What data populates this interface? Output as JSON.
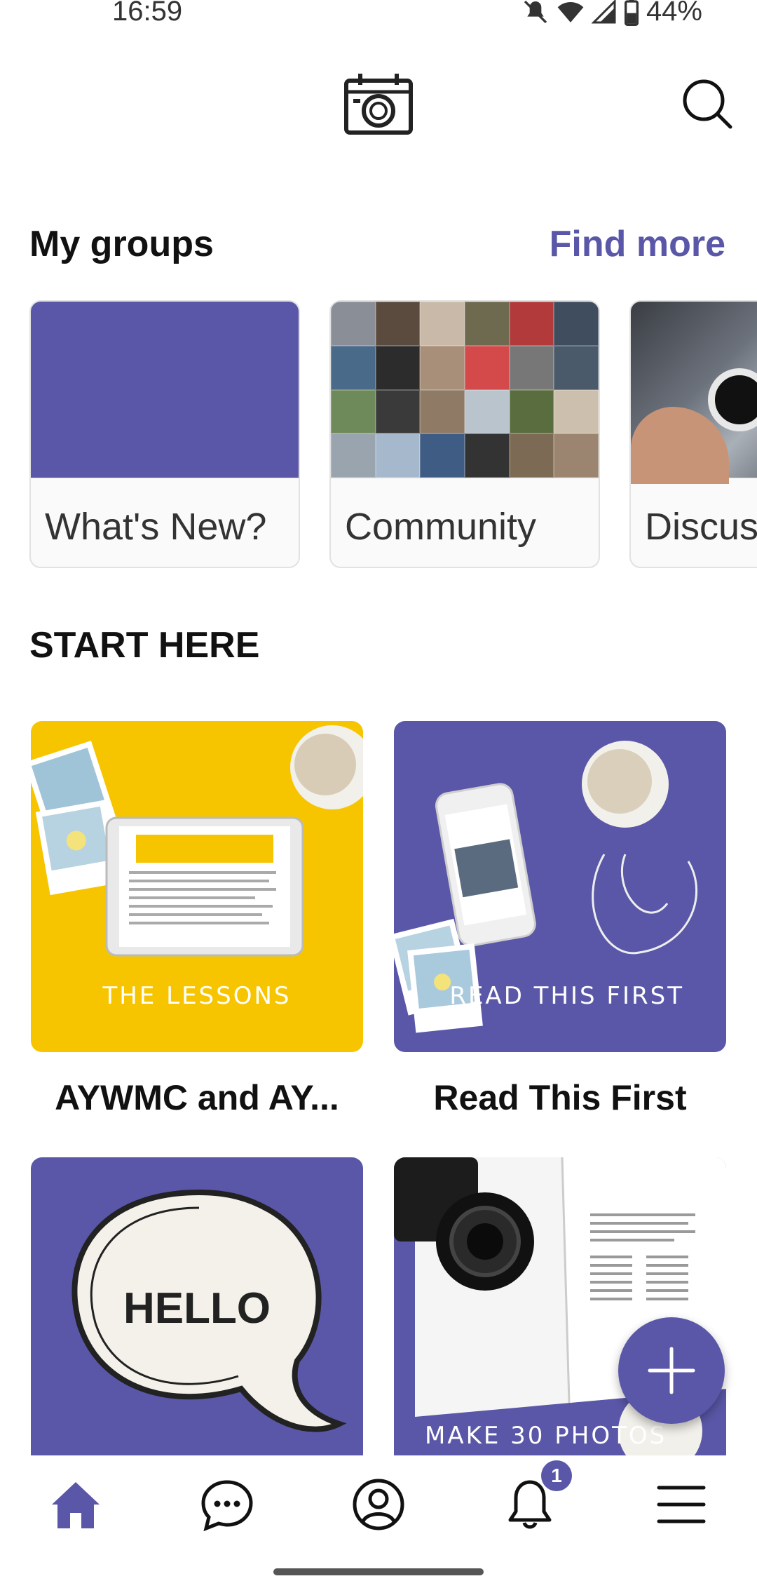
{
  "status_bar": {
    "time": "16:59",
    "battery": "44%"
  },
  "header": {
    "logo_icon": "camera-calendar-icon",
    "search_icon": "search-icon"
  },
  "my_groups": {
    "title": "My groups",
    "find_more": "Find more",
    "groups": [
      {
        "label": "What's New?"
      },
      {
        "label": "Community"
      },
      {
        "label": "Discus"
      }
    ]
  },
  "start_here": {
    "title": "START HERE",
    "tiles": [
      {
        "image_text": "THE LESSONS",
        "caption": "AYWMC and AY..."
      },
      {
        "image_text": "READ THIS FIRST",
        "caption": "Read This First"
      },
      {
        "image_text": "HELLO",
        "caption": ""
      },
      {
        "image_text": "MAKE 30 PHOTOS",
        "caption": ""
      }
    ]
  },
  "bottom_nav": {
    "items": [
      "home-icon",
      "chat-icon",
      "profile-icon",
      "bell-icon",
      "menu-icon"
    ],
    "notification_count": "1"
  },
  "colors": {
    "accent": "#5a57a8",
    "yellow": "#f6c500"
  }
}
